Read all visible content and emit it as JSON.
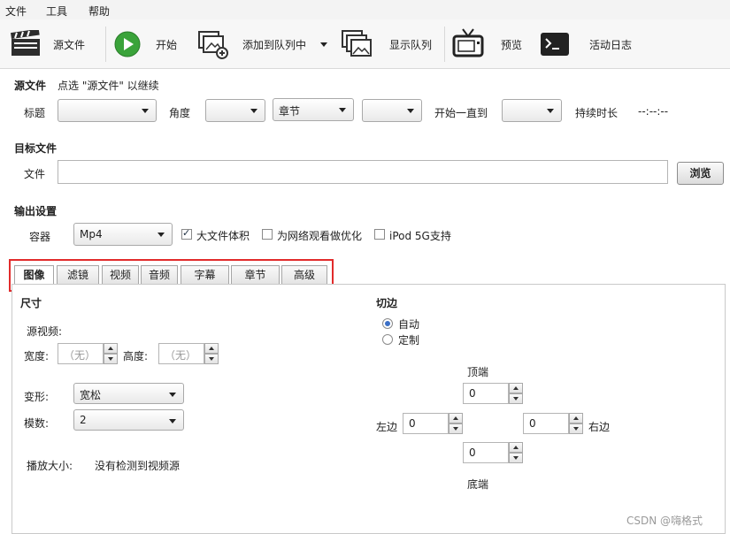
{
  "menu": {
    "items": [
      "文件",
      "工具",
      "帮助"
    ]
  },
  "toolbar": {
    "source_label": "源文件",
    "start_label": "开始",
    "add_queue_label": "添加到队列中",
    "show_queue_label": "显示队列",
    "preview_label": "预览",
    "activity_log_label": "活动日志"
  },
  "source": {
    "title": "源文件",
    "hint": "点选 \"源文件\" 以继续",
    "title_label": "标题",
    "angle_label": "角度",
    "chapter_dropdown": "章节",
    "range_label": "开始一直到",
    "duration_label": "持续时长",
    "duration_value": "--:--:--"
  },
  "destination": {
    "title": "目标文件",
    "file_label": "文件",
    "file_value": "",
    "browse_label": "浏览"
  },
  "output": {
    "title": "输出设置",
    "container_label": "容器",
    "container_value": "Mp4",
    "large_file_label": "大文件体积",
    "large_file_checked": true,
    "web_optimize_label": "为网络观看做优化",
    "web_optimize_checked": false,
    "ipod_label": "iPod 5G支持",
    "ipod_checked": false
  },
  "tabs": [
    "图像",
    "滤镜",
    "视频",
    "音频",
    "字幕",
    "章节",
    "高级"
  ],
  "active_tab": "图像",
  "picture": {
    "size_title": "尺寸",
    "source_video_label": "源视频:",
    "width_label": "宽度:",
    "width_value": "（无）",
    "height_label": "高度:",
    "height_value": "（无）",
    "anamorphic_label": "变形:",
    "anamorphic_value": "宽松",
    "modulus_label": "模数:",
    "modulus_value": "2",
    "display_size_label": "播放大小:",
    "display_size_value": "没有检测到视频源",
    "crop_title": "切边",
    "crop_auto": "自动",
    "crop_custom": "定制",
    "crop_selected": "自动",
    "top_label": "顶端",
    "top_value": "0",
    "left_label": "左边",
    "left_value": "0",
    "right_label": "右边",
    "right_value": "0",
    "bottom_label": "底端",
    "bottom_value": "0"
  },
  "watermark": "CSDN @嗨格式",
  "colors": {
    "highlight_border": "#e12b2b",
    "play_green": "#3aa33a"
  }
}
